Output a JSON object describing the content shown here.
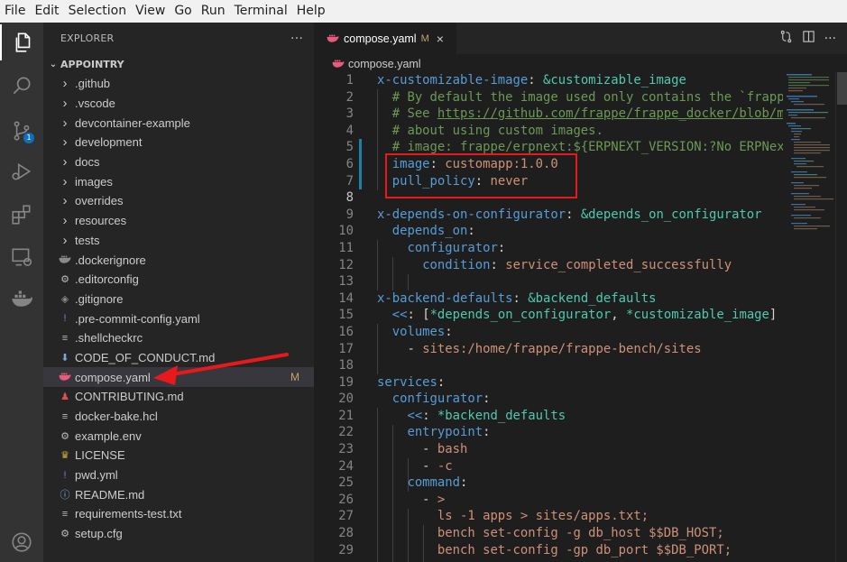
{
  "menu": [
    "File",
    "Edit",
    "Selection",
    "View",
    "Go",
    "Run",
    "Terminal",
    "Help"
  ],
  "activity_bar": {
    "icons": [
      "files-icon",
      "search-icon",
      "source-control-icon",
      "run-debug-icon",
      "extensions-icon",
      "remote-explorer-icon",
      "docker-icon",
      "account-icon"
    ],
    "scm_badge": "1"
  },
  "sidebar": {
    "title": "EXPLORER",
    "more": "···",
    "section": "APPOINTRY",
    "items": [
      {
        "label": ".github",
        "type": "folder"
      },
      {
        "label": ".vscode",
        "type": "folder"
      },
      {
        "label": "devcontainer-example",
        "type": "folder"
      },
      {
        "label": "development",
        "type": "folder"
      },
      {
        "label": "docs",
        "type": "folder"
      },
      {
        "label": "images",
        "type": "folder"
      },
      {
        "label": "overrides",
        "type": "folder"
      },
      {
        "label": "resources",
        "type": "folder"
      },
      {
        "label": "tests",
        "type": "folder"
      },
      {
        "label": ".dockerignore",
        "type": "docker"
      },
      {
        "label": ".editorconfig",
        "type": "gear"
      },
      {
        "label": ".gitignore",
        "type": "git"
      },
      {
        "label": ".pre-commit-config.yaml",
        "type": "yaml"
      },
      {
        "label": ".shellcheckrc",
        "type": "lines"
      },
      {
        "label": "CODE_OF_CONDUCT.md",
        "type": "md"
      },
      {
        "label": "compose.yaml",
        "type": "compose",
        "modified": "M"
      },
      {
        "label": "CONTRIBUTING.md",
        "type": "contrib"
      },
      {
        "label": "docker-bake.hcl",
        "type": "lines"
      },
      {
        "label": "example.env",
        "type": "gear"
      },
      {
        "label": "LICENSE",
        "type": "license"
      },
      {
        "label": "pwd.yml",
        "type": "yaml"
      },
      {
        "label": "README.md",
        "type": "info"
      },
      {
        "label": "requirements-test.txt",
        "type": "lines"
      },
      {
        "label": "setup.cfg",
        "type": "gear"
      }
    ]
  },
  "editor": {
    "tab": {
      "label": "compose.yaml",
      "modified": "M",
      "close": "×"
    },
    "breadcrumb": "compose.yaml",
    "actions": [
      "compare-icon",
      "split-editor-icon",
      "more-icon"
    ],
    "lines": [
      {
        "n": "1",
        "segs": [
          [
            "k",
            "x-customizable-image"
          ],
          [
            "p",
            ": "
          ],
          [
            "a",
            "&customizable_image"
          ]
        ]
      },
      {
        "n": "2",
        "segs": [
          [
            "p",
            "  "
          ],
          [
            "c",
            "# By default the image used only contains the `frapp"
          ]
        ]
      },
      {
        "n": "3",
        "segs": [
          [
            "p",
            "  "
          ],
          [
            "c",
            "# See "
          ],
          [
            "u",
            "https://github.com/frappe/frappe_docker/blob/m"
          ]
        ]
      },
      {
        "n": "4",
        "segs": [
          [
            "p",
            "  "
          ],
          [
            "c",
            "# about using custom images."
          ]
        ]
      },
      {
        "n": "5",
        "segs": [
          [
            "p",
            "  "
          ],
          [
            "c",
            "# image: frappe/erpnext:${ERPNEXT_VERSION:?No ERPNex"
          ]
        ]
      },
      {
        "n": "6",
        "segs": [
          [
            "p",
            "  "
          ],
          [
            "k",
            "image"
          ],
          [
            "p",
            ": "
          ],
          [
            "s",
            "customapp:1.0.0"
          ]
        ]
      },
      {
        "n": "7",
        "segs": [
          [
            "p",
            "  "
          ],
          [
            "k",
            "pull_policy"
          ],
          [
            "p",
            ": "
          ],
          [
            "s",
            "never"
          ]
        ]
      },
      {
        "n": "8",
        "segs": [
          [
            "p",
            ""
          ]
        ],
        "current": true
      },
      {
        "n": "9",
        "segs": [
          [
            "k",
            "x-depends-on-configurator"
          ],
          [
            "p",
            ": "
          ],
          [
            "a",
            "&depends_on_configurator"
          ]
        ]
      },
      {
        "n": "10",
        "segs": [
          [
            "p",
            "  "
          ],
          [
            "k",
            "depends_on"
          ],
          [
            "p",
            ":"
          ]
        ]
      },
      {
        "n": "11",
        "segs": [
          [
            "p",
            "    "
          ],
          [
            "k",
            "configurator"
          ],
          [
            "p",
            ":"
          ]
        ]
      },
      {
        "n": "12",
        "segs": [
          [
            "p",
            "      "
          ],
          [
            "k",
            "condition"
          ],
          [
            "p",
            ": "
          ],
          [
            "s",
            "service_completed_successfully"
          ]
        ]
      },
      {
        "n": "13",
        "segs": [
          [
            "p",
            ""
          ]
        ]
      },
      {
        "n": "14",
        "segs": [
          [
            "k",
            "x-backend-defaults"
          ],
          [
            "p",
            ": "
          ],
          [
            "a",
            "&backend_defaults"
          ]
        ]
      },
      {
        "n": "15",
        "segs": [
          [
            "p",
            "  "
          ],
          [
            "k",
            "<<"
          ],
          [
            "p",
            ": ["
          ],
          [
            "a",
            "*depends_on_configurator"
          ],
          [
            "p",
            ", "
          ],
          [
            "a",
            "*customizable_image"
          ],
          [
            "p",
            "]"
          ]
        ]
      },
      {
        "n": "16",
        "segs": [
          [
            "p",
            "  "
          ],
          [
            "k",
            "volumes"
          ],
          [
            "p",
            ":"
          ]
        ]
      },
      {
        "n": "17",
        "segs": [
          [
            "p",
            "    - "
          ],
          [
            "s",
            "sites:/home/frappe/frappe-bench/sites"
          ]
        ]
      },
      {
        "n": "18",
        "segs": [
          [
            "p",
            ""
          ]
        ]
      },
      {
        "n": "19",
        "segs": [
          [
            "k",
            "services"
          ],
          [
            "p",
            ":"
          ]
        ]
      },
      {
        "n": "20",
        "segs": [
          [
            "p",
            "  "
          ],
          [
            "k",
            "configurator"
          ],
          [
            "p",
            ":"
          ]
        ]
      },
      {
        "n": "21",
        "segs": [
          [
            "p",
            "    "
          ],
          [
            "k",
            "<<"
          ],
          [
            "p",
            ": "
          ],
          [
            "a",
            "*backend_defaults"
          ]
        ]
      },
      {
        "n": "22",
        "segs": [
          [
            "p",
            "    "
          ],
          [
            "k",
            "entrypoint"
          ],
          [
            "p",
            ":"
          ]
        ]
      },
      {
        "n": "23",
        "segs": [
          [
            "p",
            "      - "
          ],
          [
            "s",
            "bash"
          ]
        ]
      },
      {
        "n": "24",
        "segs": [
          [
            "p",
            "      - "
          ],
          [
            "s",
            "-c"
          ]
        ]
      },
      {
        "n": "25",
        "segs": [
          [
            "p",
            "    "
          ],
          [
            "k",
            "command"
          ],
          [
            "p",
            ":"
          ]
        ]
      },
      {
        "n": "26",
        "segs": [
          [
            "p",
            "      - "
          ],
          [
            "s",
            ">"
          ]
        ]
      },
      {
        "n": "27",
        "segs": [
          [
            "p",
            "        "
          ],
          [
            "s",
            "ls -1 apps > sites/apps.txt;"
          ]
        ]
      },
      {
        "n": "28",
        "segs": [
          [
            "p",
            "        "
          ],
          [
            "s",
            "bench set-config -g db_host $$DB_HOST;"
          ]
        ]
      },
      {
        "n": "29",
        "segs": [
          [
            "p",
            "        "
          ],
          [
            "s",
            "bench set-config -gp db_port $$DB_PORT;"
          ]
        ]
      }
    ]
  },
  "colors": {
    "activity_bar": "#333333",
    "sidebar": "#252526",
    "editor_bg": "#1e1e1e",
    "highlight_box": "#e8191b",
    "annotation_arrow": "#e8191b",
    "modified": "#c5a36a"
  }
}
